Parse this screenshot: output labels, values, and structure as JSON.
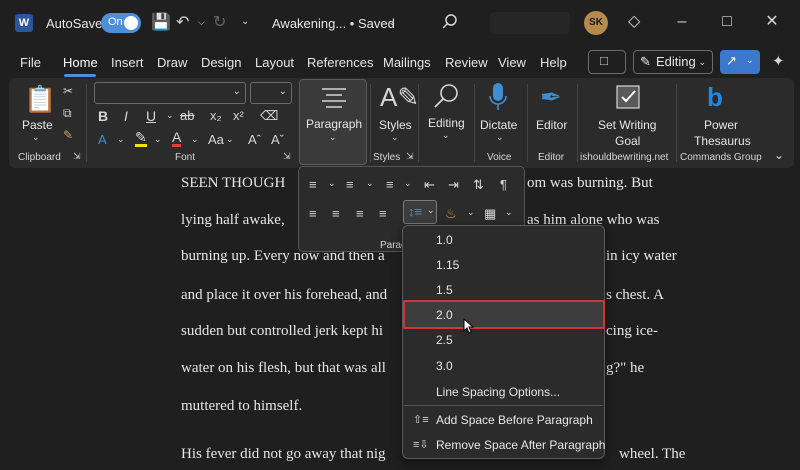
{
  "titlebar": {
    "autosave_label": "AutoSave",
    "autosave_state": "On",
    "doc_title": "Awakening... • Saved",
    "avatar_initials": "SK"
  },
  "menu": {
    "tabs": [
      "File",
      "Home",
      "Insert",
      "Draw",
      "Design",
      "Layout",
      "References",
      "Mailings",
      "Review",
      "View",
      "Help"
    ],
    "active": "Home",
    "editing_label": "Editing"
  },
  "ribbon": {
    "paste_label": "Paste",
    "clipboard_group": "Clipboard",
    "font_group": "Font",
    "paragraph_label": "Paragraph",
    "styles_label": "Styles",
    "styles_group": "Styles",
    "editing_label": "Editing",
    "dictate_label": "Dictate",
    "voice_group": "Voice",
    "editor_label": "Editor",
    "editor_group": "Editor",
    "swg_label_1": "Set Writing",
    "swg_label_2": "Goal",
    "swg_group": "ishouldbewriting.net",
    "pt_label_1": "Power",
    "pt_label_2": "Thesaurus",
    "pt_group": "Commands Group",
    "paragraph_group": "Paragraph"
  },
  "document": {
    "lines": [
      "SEEN THOUGH",
      "om was burning. But",
      "lying half awake,",
      "as him alone who was",
      "burning up. Every now and then a",
      "in icy water",
      "and place it over his forehead, and",
      "s chest. A",
      "sudden but controlled jerk kept hi",
      "cing ice-",
      "water on his flesh, but that was all",
      "g?\" he",
      "muttered to himself.",
      "His fever did not go away that nig",
      "wheel. The"
    ]
  },
  "line_spacing_menu": {
    "options": [
      "1.0",
      "1.15",
      "1.5",
      "2.0",
      "2.5",
      "3.0"
    ],
    "selected": "2.0",
    "options_label": "Line Spacing Options...",
    "add_before": "Add Space Before Paragraph",
    "remove_after": "Remove Space After Paragraph"
  },
  "colors": {
    "accent": "#4f8fda",
    "highlight_border": "#d13438",
    "background": "#1f1f1f",
    "ribbon": "#2b2b2b"
  }
}
